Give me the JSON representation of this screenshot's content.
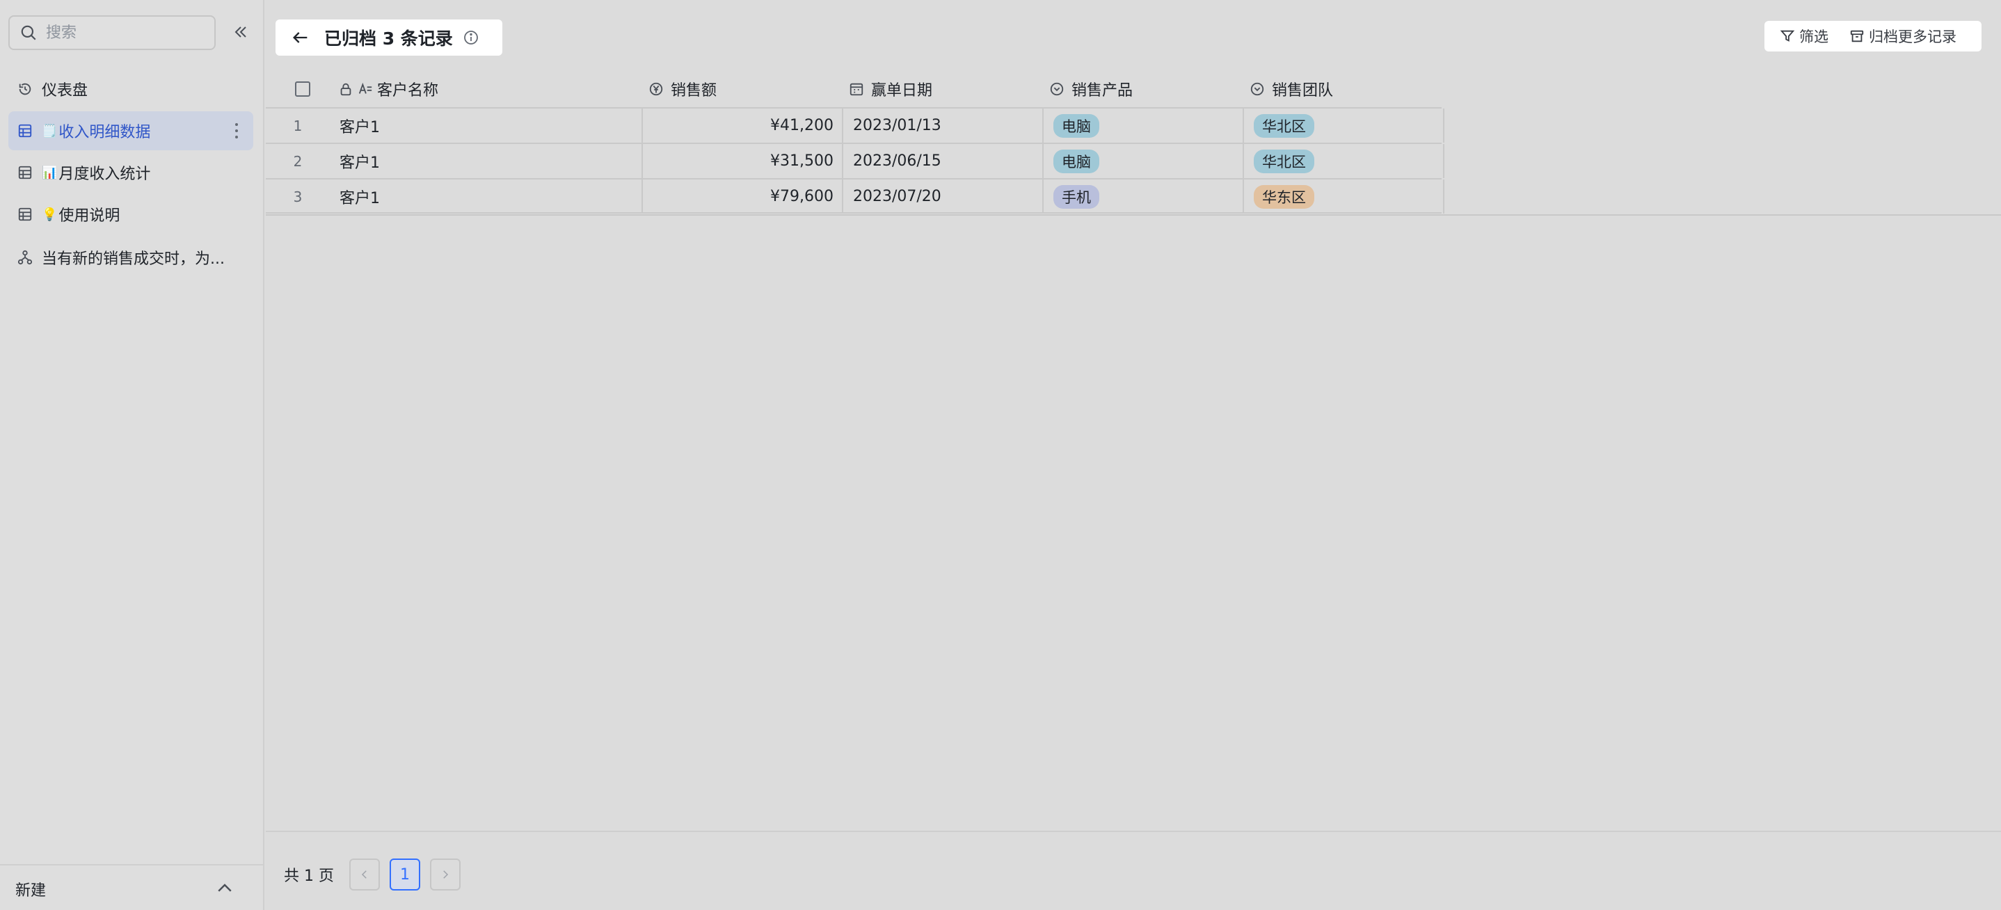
{
  "sidebar": {
    "search_placeholder": "搜索",
    "items": [
      {
        "label": "仪表盘",
        "emoji": ""
      },
      {
        "label": "收入明细数据",
        "emoji": "🗒️"
      },
      {
        "label": "月度收入统计",
        "emoji": "📊"
      },
      {
        "label": "使用说明",
        "emoji": "💡"
      },
      {
        "label": "当有新的销售成交时，为...",
        "emoji": ""
      }
    ],
    "new_label": "新建"
  },
  "header": {
    "title": "已归档 3 条记录"
  },
  "toolbar": {
    "filter_label": "筛选",
    "archive_more_label": "归档更多记录"
  },
  "table": {
    "columns": [
      "客户名称",
      "销售额",
      "赢单日期",
      "销售产品",
      "销售团队"
    ],
    "rows": [
      {
        "index": "1",
        "customer": "客户1",
        "amount": "¥41,200",
        "date": "2023/01/13",
        "product": "电脑",
        "team": "华北区"
      },
      {
        "index": "2",
        "customer": "客户1",
        "amount": "¥31,500",
        "date": "2023/06/15",
        "product": "电脑",
        "team": "华北区"
      },
      {
        "index": "3",
        "customer": "客户1",
        "amount": "¥79,600",
        "date": "2023/07/20",
        "product": "手机",
        "team": "华东区"
      }
    ]
  },
  "tag_colors": {
    "电脑": "#9fc8d6",
    "手机": "#b9bfdc",
    "华北区": "#9fc8d6",
    "华东区": "#e2c19f"
  },
  "pagination": {
    "total_label": "共 1 页",
    "current_page": "1"
  }
}
